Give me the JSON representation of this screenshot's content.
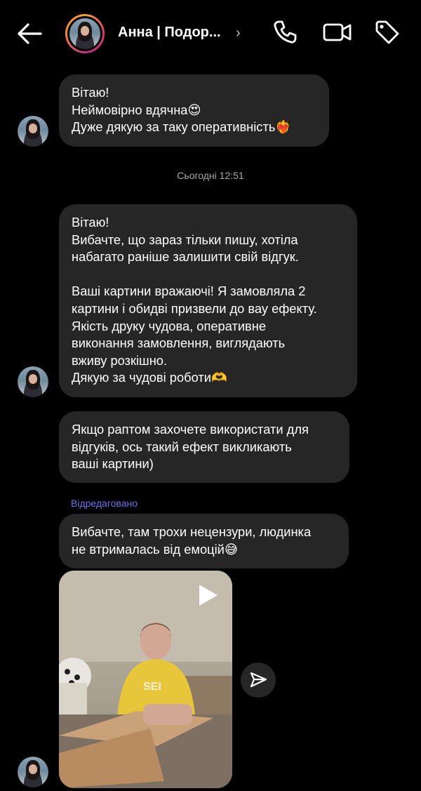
{
  "header": {
    "contact_name": "Анна | Подор...",
    "chevron": "›",
    "icons": [
      "back-arrow-icon",
      "phone-icon",
      "video-camera-icon",
      "tag-icon"
    ]
  },
  "messages": [
    {
      "text": "Вітаю!\nНеймовірно вдячна😍\nДуже дякую за таку оперативність❤️‍🔥"
    },
    {
      "text": "Вітаю!\nВибачте, що зараз тільки пишу, хотіла\nнабагато раніше залишити свій відгук.\n\nВаші картини вражаючі! Я замовляла 2\nкартини і обидві призвели до вау ефекту.\nЯкість друку чудова, оперативне\nвиконання замовлення, виглядають\nвживу розкішно.\nДякую за чудові роботи🫶"
    },
    {
      "text": "Якщо раптом захочете використати для\nвідгуків, ось такий ефект викликають\nваші картини)"
    },
    {
      "text": "Вибачте, там трохи нецензури, людинка\nне втрималась від емоцій😅"
    }
  ],
  "timestamp": "Сьогодні 12:51",
  "edited_label": "Відредаговано",
  "video": {
    "play_icon": "play-icon",
    "share_icon": "send-icon"
  },
  "colors": {
    "background": "#000000",
    "bubble": "#262626",
    "edited": "#6c73e8",
    "meta_text": "#a8a8a8"
  }
}
